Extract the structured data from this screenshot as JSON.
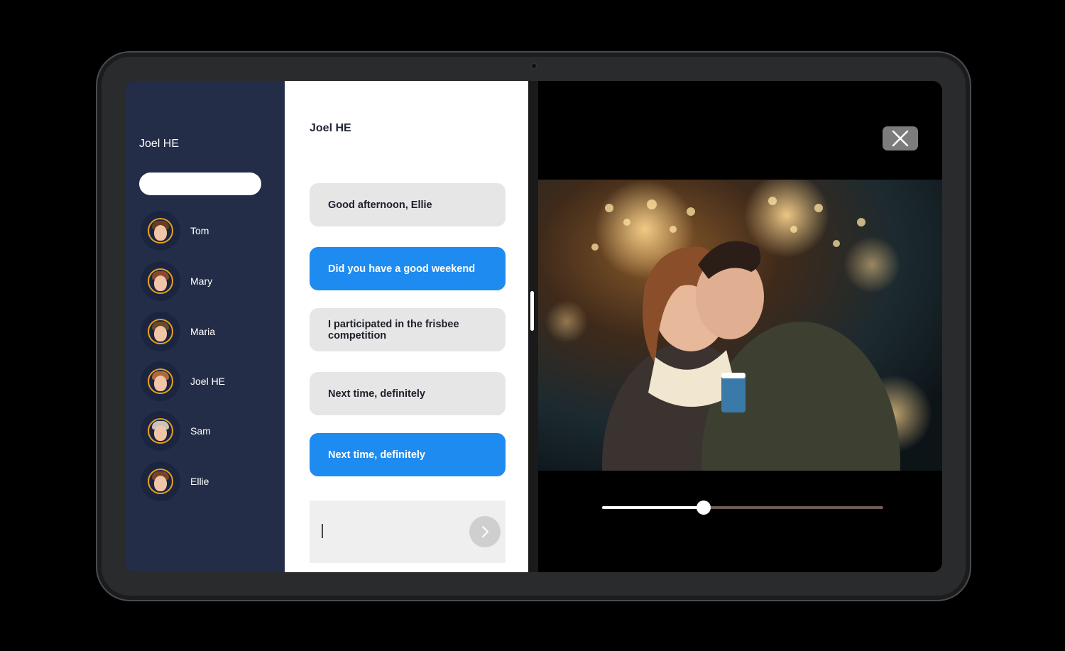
{
  "sidebar": {
    "title": "Joel HE",
    "search": {
      "value": "",
      "placeholder": ""
    },
    "contacts": [
      {
        "name": "Tom",
        "hair": "#6b3e1d"
      },
      {
        "name": "Mary",
        "hair": "#8a4a2a"
      },
      {
        "name": "Maria",
        "hair": "#6b4a2c"
      },
      {
        "name": "Joel HE",
        "hair": "#b06a3a"
      },
      {
        "name": "Sam",
        "hair": "#c9c3ba"
      },
      {
        "name": "Ellie",
        "hair": "#7a4327"
      }
    ]
  },
  "chat": {
    "title": "Joel HE",
    "messages": [
      {
        "text": "Good afternoon, Ellie",
        "direction": "in"
      },
      {
        "text": "Did you have a good weekend",
        "direction": "out"
      },
      {
        "text": "I participated in the frisbee competition",
        "direction": "in"
      },
      {
        "text": "Next time, definitely",
        "direction": "in"
      },
      {
        "text": "Next time, definitely",
        "direction": "out"
      }
    ],
    "composer": {
      "value": "",
      "placeholder": ""
    }
  },
  "media": {
    "progress": 0.36
  },
  "colors": {
    "sidebar_bg": "#232d47",
    "outgoing_bubble": "#1e8bf0",
    "incoming_bubble": "#e6e6e6",
    "avatar_ring": "#e8a11b"
  },
  "icons": {
    "close": "close-icon",
    "send": "chevron-right-icon"
  }
}
